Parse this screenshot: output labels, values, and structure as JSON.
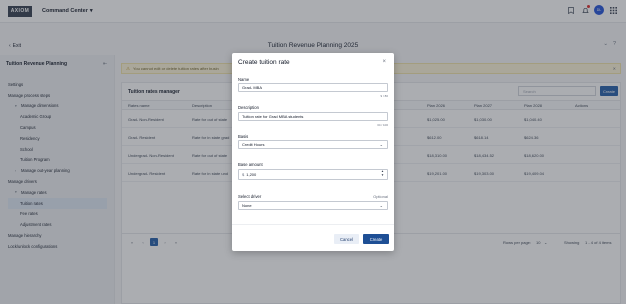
{
  "topbar": {
    "logo": "AXIOM",
    "app_name": "Command Center",
    "app_caret": "▾",
    "avatar_initials": "DL"
  },
  "subheader": {
    "exit_label": "Exit",
    "page_title": "Tuition Revenue Planning 2025"
  },
  "sidebar": {
    "title": "Tuition Revenue Planning",
    "items": [
      {
        "label": "Settings",
        "level": "l0c",
        "caret": ""
      },
      {
        "label": "Manage process steps",
        "level": "l0c",
        "caret": ""
      },
      {
        "label": "Manage dimensions",
        "level": "l0",
        "caret": "▾"
      },
      {
        "label": "Academic Group",
        "level": "l1",
        "caret": ""
      },
      {
        "label": "Campus",
        "level": "l1",
        "caret": ""
      },
      {
        "label": "Residency",
        "level": "l1",
        "caret": ""
      },
      {
        "label": "School",
        "level": "l1",
        "caret": ""
      },
      {
        "label": "Tuition Program",
        "level": "l1",
        "caret": ""
      },
      {
        "label": "Manage out-year planning",
        "level": "l0",
        "caret": "›"
      },
      {
        "label": "Manage drivers",
        "level": "l0c",
        "caret": ""
      },
      {
        "label": "Manage rates",
        "level": "l0",
        "caret": "▾"
      },
      {
        "label": "Tuition rates",
        "level": "active",
        "caret": ""
      },
      {
        "label": "Fee rates",
        "level": "l1",
        "caret": ""
      },
      {
        "label": "Adjustment rates",
        "level": "l1",
        "caret": ""
      },
      {
        "label": "Manage hierarchy",
        "level": "l0c",
        "caret": ""
      },
      {
        "label": "Lock/unlock configurations",
        "level": "l0c",
        "caret": ""
      }
    ]
  },
  "main": {
    "warning": "You cannot edit or delete tuition rates after busin",
    "card_title": "Tuition rates manager",
    "search_placeholder": "Search",
    "create_label": "Create",
    "columns": [
      "Rates name",
      "Description",
      "Plan 2025",
      "Plan 2026",
      "Plan 2027",
      "Plan 2028",
      "Actions"
    ],
    "rows": [
      {
        "name": "Grad- Non-Resident",
        "desc": "Rate for out of state",
        "p25": "$1,016.00",
        "p26": "$1,025.00",
        "p27": "$1,030.00",
        "p28": "$1,040.40"
      },
      {
        "name": "Grad- Resident",
        "desc": "Rate for in state grad",
        "p25": "$610.00",
        "p26": "$612.00",
        "p27": "$618.14",
        "p28": "$624.36"
      },
      {
        "name": "Undergrad- Non-Resident",
        "desc": "Rate for out of state",
        "p25": "$18,250.00",
        "p26": "$18,310.00",
        "p27": "$18,434.52",
        "p28": "$18,620.00"
      },
      {
        "name": "Undergrad- Resident",
        "desc": "Rate for in state und",
        "p25": "$19,200.00",
        "p26": "$19,201.00",
        "p27": "$19,303.00",
        "p28": "$19,409.04"
      }
    ],
    "pager": {
      "current_page": "1",
      "rows_per_page_label": "Rows per page:",
      "rows_per_page": "10",
      "showing": "Showing",
      "range": "1 - 4 of 4 items"
    }
  },
  "modal": {
    "title": "Create tuition rate",
    "name_label": "Name",
    "name_value": "Grad- MBA",
    "name_count": "9 / 80",
    "description_label": "Description",
    "description_value": "Tuition rate for Grad MBA students",
    "description_count": "34 / 100",
    "basis_label": "Basis",
    "basis_value": "Credit Hours",
    "base_amount_label": "Base amount",
    "base_amount_value": "1,200",
    "currency_symbol": "$",
    "driver_label": "Select driver",
    "driver_optional": "Optional",
    "driver_value": "None",
    "cancel_label": "Cancel",
    "create_label": "Create"
  }
}
